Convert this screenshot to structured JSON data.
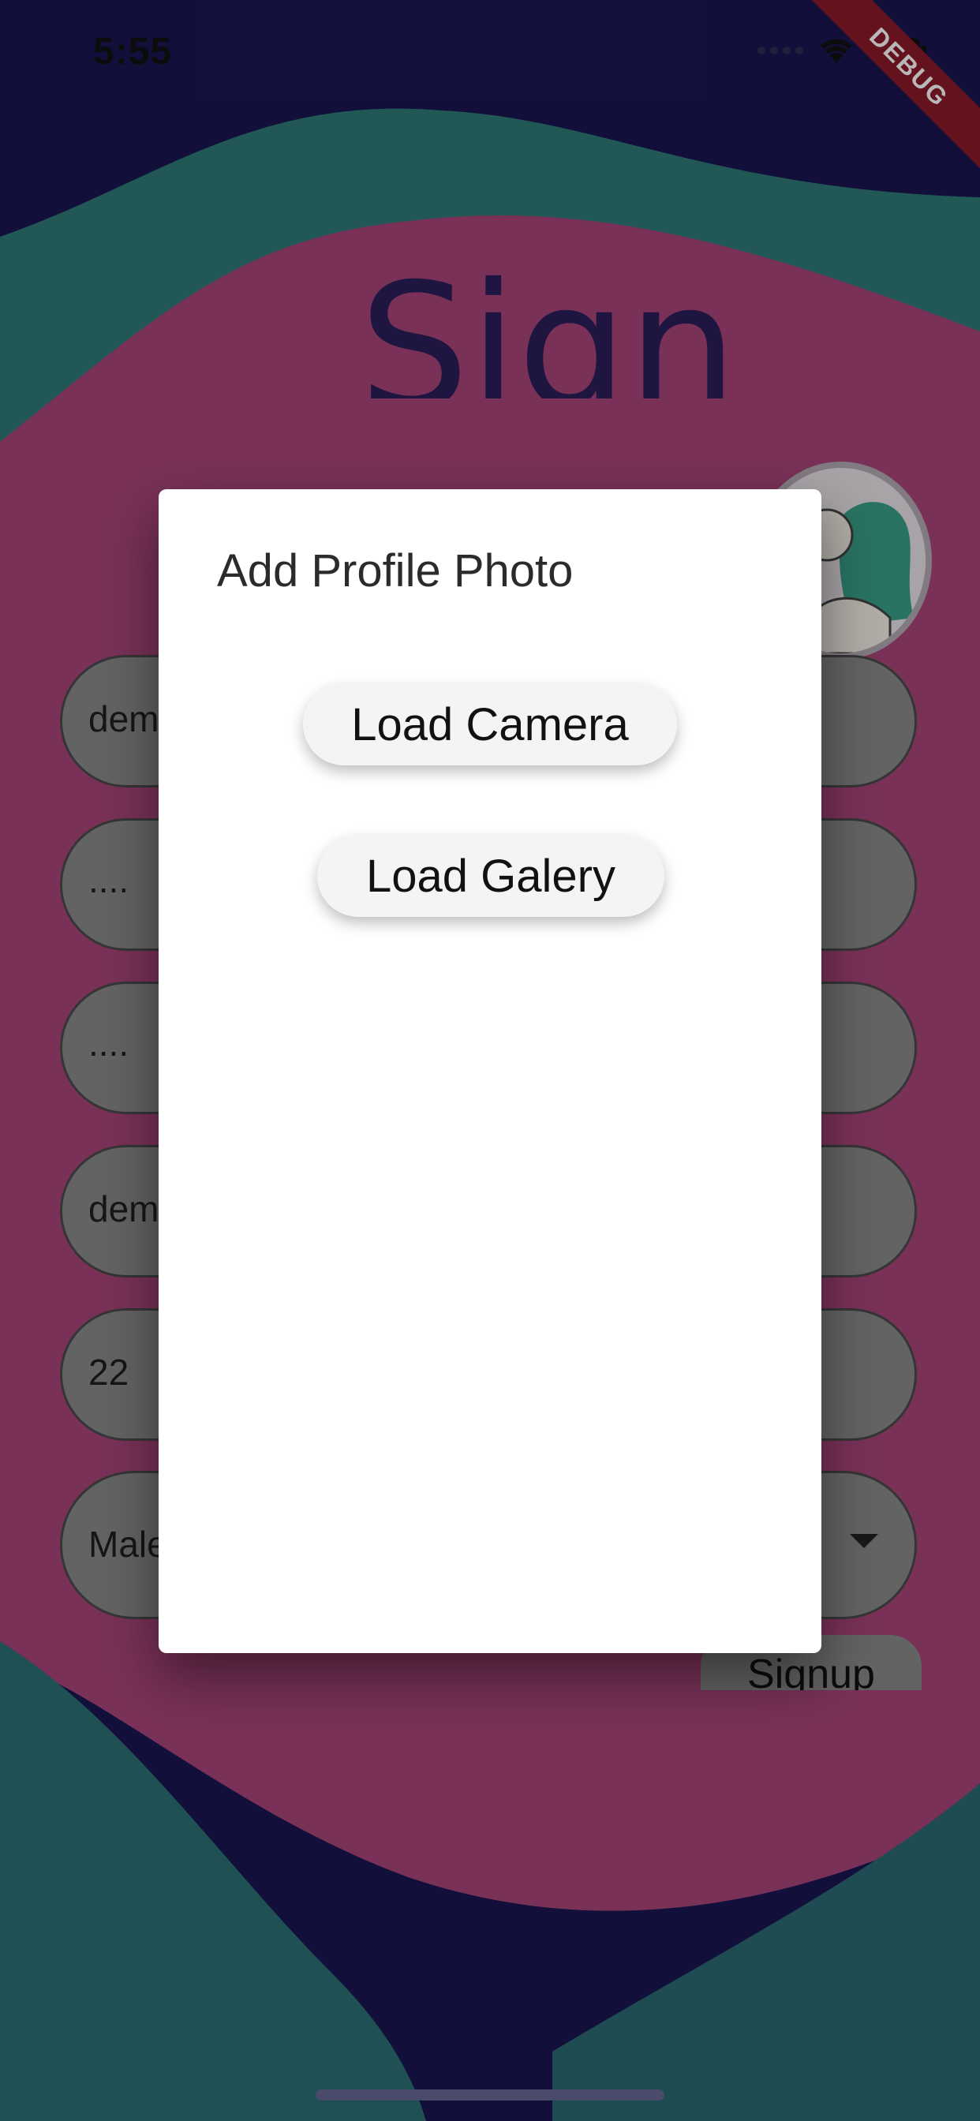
{
  "status_bar": {
    "time": "5:55",
    "debug_label": "DEBUG"
  },
  "page": {
    "title": "Sign Up",
    "fields": [
      {
        "name": "email",
        "value": "dem"
      },
      {
        "name": "password",
        "value": "...."
      },
      {
        "name": "confirm-password",
        "value": "...."
      },
      {
        "name": "username",
        "value": "dem"
      },
      {
        "name": "age",
        "value": "22"
      },
      {
        "name": "gender",
        "value": "Male"
      }
    ],
    "signup_label": "Signup"
  },
  "dialog": {
    "title": "Add Profile Photo",
    "camera_label": "Load Camera",
    "gallery_label": "Load Galery"
  },
  "colors": {
    "background": "#191752",
    "wave_pink": "#b8487a",
    "wave_teal": "#2a7f7a",
    "dialog": "#ffffff"
  }
}
